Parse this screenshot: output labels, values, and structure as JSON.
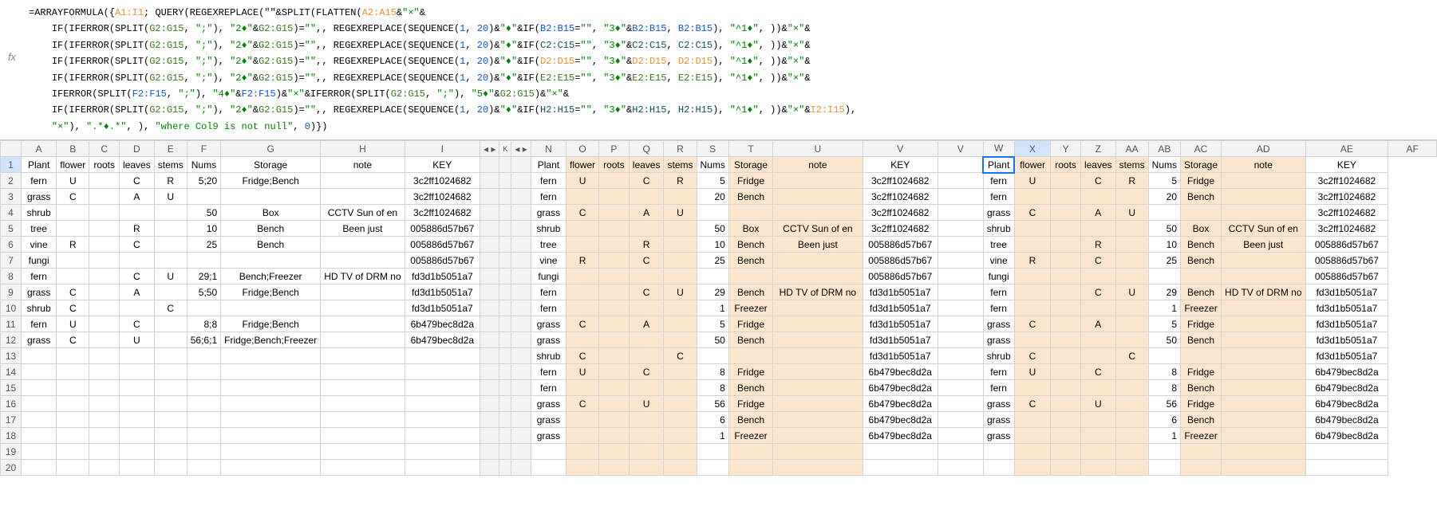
{
  "formula_bar": {
    "fx": "fx",
    "lines": [
      [
        {
          "t": "=ARRAYFORMULA({",
          "c": ""
        },
        {
          "t": "A1:I1",
          "c": "fr-orange"
        },
        {
          "t": "; QUERY(REGEXREPLACE(\"\"&SPLIT(FLATTEN(",
          "c": ""
        },
        {
          "t": "A2:A15",
          "c": "fr-orange"
        },
        {
          "t": "&",
          "c": ""
        },
        {
          "t": "\"×\"",
          "c": "fr-str"
        },
        {
          "t": "&",
          "c": ""
        }
      ],
      [
        {
          "t": "IF(IFERROR(SPLIT(",
          "c": ""
        },
        {
          "t": "G2:G15",
          "c": "fr-green"
        },
        {
          "t": ", ",
          "c": ""
        },
        {
          "t": "\";\"",
          "c": "fr-str"
        },
        {
          "t": "), ",
          "c": ""
        },
        {
          "t": "\"2♦\"",
          "c": "fr-str"
        },
        {
          "t": "&",
          "c": ""
        },
        {
          "t": "G2:G15",
          "c": "fr-green"
        },
        {
          "t": ")=",
          "c": ""
        },
        {
          "t": "\"\"",
          "c": "fr-str"
        },
        {
          "t": ",, REGEXREPLACE(SEQUENCE(",
          "c": ""
        },
        {
          "t": "1",
          "c": "fr-num"
        },
        {
          "t": ", ",
          "c": ""
        },
        {
          "t": "20",
          "c": "fr-num"
        },
        {
          "t": ")&",
          "c": ""
        },
        {
          "t": "\"♦\"",
          "c": "fr-str"
        },
        {
          "t": "&IF(",
          "c": ""
        },
        {
          "t": "B2:B15",
          "c": "fr-blue"
        },
        {
          "t": "=",
          "c": ""
        },
        {
          "t": "\"\"",
          "c": "fr-str"
        },
        {
          "t": ", ",
          "c": ""
        },
        {
          "t": "\"3♦\"",
          "c": "fr-str"
        },
        {
          "t": "&",
          "c": ""
        },
        {
          "t": "B2:B15",
          "c": "fr-blue"
        },
        {
          "t": ", ",
          "c": ""
        },
        {
          "t": "B2:B15",
          "c": "fr-blue"
        },
        {
          "t": "), ",
          "c": ""
        },
        {
          "t": "\"^1♦\"",
          "c": "fr-str"
        },
        {
          "t": ", ))&",
          "c": ""
        },
        {
          "t": "\"×\"",
          "c": "fr-str"
        },
        {
          "t": "&",
          "c": ""
        }
      ],
      [
        {
          "t": "IF(IFERROR(SPLIT(",
          "c": ""
        },
        {
          "t": "G2:G15",
          "c": "fr-green"
        },
        {
          "t": ", ",
          "c": ""
        },
        {
          "t": "\";\"",
          "c": "fr-str"
        },
        {
          "t": "), ",
          "c": ""
        },
        {
          "t": "\"2♦\"",
          "c": "fr-str"
        },
        {
          "t": "&",
          "c": ""
        },
        {
          "t": "G2:G15",
          "c": "fr-green"
        },
        {
          "t": ")=",
          "c": ""
        },
        {
          "t": "\"\"",
          "c": "fr-str"
        },
        {
          "t": ",, REGEXREPLACE(SEQUENCE(",
          "c": ""
        },
        {
          "t": "1",
          "c": "fr-num"
        },
        {
          "t": ", ",
          "c": ""
        },
        {
          "t": "20",
          "c": "fr-num"
        },
        {
          "t": ")&",
          "c": ""
        },
        {
          "t": "\"♦\"",
          "c": "fr-str"
        },
        {
          "t": "&IF(",
          "c": ""
        },
        {
          "t": "C2:C15",
          "c": "fr-teal"
        },
        {
          "t": "=",
          "c": ""
        },
        {
          "t": "\"\"",
          "c": "fr-str"
        },
        {
          "t": ", ",
          "c": ""
        },
        {
          "t": "\"3♦\"",
          "c": "fr-str"
        },
        {
          "t": "&",
          "c": ""
        },
        {
          "t": "C2:C15",
          "c": "fr-teal"
        },
        {
          "t": ", ",
          "c": ""
        },
        {
          "t": "C2:C15",
          "c": "fr-teal"
        },
        {
          "t": "), ",
          "c": ""
        },
        {
          "t": "\"^1♦\"",
          "c": "fr-str"
        },
        {
          "t": ", ))&",
          "c": ""
        },
        {
          "t": "\"×\"",
          "c": "fr-str"
        },
        {
          "t": "&",
          "c": ""
        }
      ],
      [
        {
          "t": "IF(IFERROR(SPLIT(",
          "c": ""
        },
        {
          "t": "G2:G15",
          "c": "fr-green"
        },
        {
          "t": ", ",
          "c": ""
        },
        {
          "t": "\";\"",
          "c": "fr-str"
        },
        {
          "t": "), ",
          "c": ""
        },
        {
          "t": "\"2♦\"",
          "c": "fr-str"
        },
        {
          "t": "&",
          "c": ""
        },
        {
          "t": "G2:G15",
          "c": "fr-green"
        },
        {
          "t": ")=",
          "c": ""
        },
        {
          "t": "\"\"",
          "c": "fr-str"
        },
        {
          "t": ",, REGEXREPLACE(SEQUENCE(",
          "c": ""
        },
        {
          "t": "1",
          "c": "fr-num"
        },
        {
          "t": ", ",
          "c": ""
        },
        {
          "t": "20",
          "c": "fr-num"
        },
        {
          "t": ")&",
          "c": ""
        },
        {
          "t": "\"♦\"",
          "c": "fr-str"
        },
        {
          "t": "&IF(",
          "c": ""
        },
        {
          "t": "D2:D15",
          "c": "fr-orange"
        },
        {
          "t": "=",
          "c": ""
        },
        {
          "t": "\"\"",
          "c": "fr-str"
        },
        {
          "t": ", ",
          "c": ""
        },
        {
          "t": "\"3♦\"",
          "c": "fr-str"
        },
        {
          "t": "&",
          "c": ""
        },
        {
          "t": "D2:D15",
          "c": "fr-orange"
        },
        {
          "t": ", ",
          "c": ""
        },
        {
          "t": "D2:D15",
          "c": "fr-orange"
        },
        {
          "t": "), ",
          "c": ""
        },
        {
          "t": "\"^1♦\"",
          "c": "fr-str"
        },
        {
          "t": ", ))&",
          "c": ""
        },
        {
          "t": "\"×\"",
          "c": "fr-str"
        },
        {
          "t": "&",
          "c": ""
        }
      ],
      [
        {
          "t": "IF(IFERROR(SPLIT(",
          "c": ""
        },
        {
          "t": "G2:G15",
          "c": "fr-green"
        },
        {
          "t": ", ",
          "c": ""
        },
        {
          "t": "\";\"",
          "c": "fr-str"
        },
        {
          "t": "), ",
          "c": ""
        },
        {
          "t": "\"2♦\"",
          "c": "fr-str"
        },
        {
          "t": "&",
          "c": ""
        },
        {
          "t": "G2:G15",
          "c": "fr-green"
        },
        {
          "t": ")=",
          "c": ""
        },
        {
          "t": "\"\"",
          "c": "fr-str"
        },
        {
          "t": ",, REGEXREPLACE(SEQUENCE(",
          "c": ""
        },
        {
          "t": "1",
          "c": "fr-num"
        },
        {
          "t": ", ",
          "c": ""
        },
        {
          "t": "20",
          "c": "fr-num"
        },
        {
          "t": ")&",
          "c": ""
        },
        {
          "t": "\"♦\"",
          "c": "fr-str"
        },
        {
          "t": "&IF(",
          "c": ""
        },
        {
          "t": "E2:E15",
          "c": "fr-green"
        },
        {
          "t": "=",
          "c": ""
        },
        {
          "t": "\"\"",
          "c": "fr-str"
        },
        {
          "t": ", ",
          "c": ""
        },
        {
          "t": "\"3♦\"",
          "c": "fr-str"
        },
        {
          "t": "&",
          "c": ""
        },
        {
          "t": "E2:E15",
          "c": "fr-green"
        },
        {
          "t": ", ",
          "c": ""
        },
        {
          "t": "E2:E15",
          "c": "fr-green"
        },
        {
          "t": "), ",
          "c": ""
        },
        {
          "t": "\"^1♦\"",
          "c": "fr-str"
        },
        {
          "t": ", ))&",
          "c": ""
        },
        {
          "t": "\"×\"",
          "c": "fr-str"
        },
        {
          "t": "&",
          "c": ""
        }
      ],
      [
        {
          "t": "IFERROR(SPLIT(",
          "c": ""
        },
        {
          "t": "F2:F15",
          "c": "fr-blue"
        },
        {
          "t": ", ",
          "c": ""
        },
        {
          "t": "\";\"",
          "c": "fr-str"
        },
        {
          "t": "), ",
          "c": ""
        },
        {
          "t": "\"4♦\"",
          "c": "fr-str"
        },
        {
          "t": "&",
          "c": ""
        },
        {
          "t": "F2:F15",
          "c": "fr-blue"
        },
        {
          "t": ")&",
          "c": ""
        },
        {
          "t": "\"×\"",
          "c": "fr-str"
        },
        {
          "t": "&IFERROR(SPLIT(",
          "c": ""
        },
        {
          "t": "G2:G15",
          "c": "fr-green"
        },
        {
          "t": ", ",
          "c": ""
        },
        {
          "t": "\";\"",
          "c": "fr-str"
        },
        {
          "t": "), ",
          "c": ""
        },
        {
          "t": "\"5♦\"",
          "c": "fr-str"
        },
        {
          "t": "&",
          "c": ""
        },
        {
          "t": "G2:G15",
          "c": "fr-green"
        },
        {
          "t": ")&",
          "c": ""
        },
        {
          "t": "\"×\"",
          "c": "fr-str"
        },
        {
          "t": "&",
          "c": ""
        }
      ],
      [
        {
          "t": "IF(IFERROR(SPLIT(",
          "c": ""
        },
        {
          "t": "G2:G15",
          "c": "fr-green"
        },
        {
          "t": ", ",
          "c": ""
        },
        {
          "t": "\";\"",
          "c": "fr-str"
        },
        {
          "t": "), ",
          "c": ""
        },
        {
          "t": "\"2♦\"",
          "c": "fr-str"
        },
        {
          "t": "&",
          "c": ""
        },
        {
          "t": "G2:G15",
          "c": "fr-green"
        },
        {
          "t": ")=",
          "c": ""
        },
        {
          "t": "\"\"",
          "c": "fr-str"
        },
        {
          "t": ",, REGEXREPLACE(SEQUENCE(",
          "c": ""
        },
        {
          "t": "1",
          "c": "fr-num"
        },
        {
          "t": ", ",
          "c": ""
        },
        {
          "t": "20",
          "c": "fr-num"
        },
        {
          "t": ")&",
          "c": ""
        },
        {
          "t": "\"♦\"",
          "c": "fr-str"
        },
        {
          "t": "&IF(",
          "c": ""
        },
        {
          "t": "H2:H15",
          "c": "fr-teal"
        },
        {
          "t": "=",
          "c": ""
        },
        {
          "t": "\"\"",
          "c": "fr-str"
        },
        {
          "t": ", ",
          "c": ""
        },
        {
          "t": "\"3♦\"",
          "c": "fr-str"
        },
        {
          "t": "&",
          "c": ""
        },
        {
          "t": "H2:H15",
          "c": "fr-teal"
        },
        {
          "t": ", ",
          "c": ""
        },
        {
          "t": "H2:H15",
          "c": "fr-teal"
        },
        {
          "t": "), ",
          "c": ""
        },
        {
          "t": "\"^1♦\"",
          "c": "fr-str"
        },
        {
          "t": ", ))&",
          "c": ""
        },
        {
          "t": "\"×\"",
          "c": "fr-str"
        },
        {
          "t": "&",
          "c": ""
        },
        {
          "t": "I2:I15",
          "c": "fr-orange"
        },
        {
          "t": "),",
          "c": ""
        }
      ],
      [
        {
          "t": "\"×\"",
          "c": "fr-str"
        },
        {
          "t": "), ",
          "c": ""
        },
        {
          "t": "\".*♦.*\"",
          "c": "fr-str"
        },
        {
          "t": ", ), ",
          "c": ""
        },
        {
          "t": "\"where Col9 is not null\"",
          "c": "fr-str"
        },
        {
          "t": ", ",
          "c": ""
        },
        {
          "t": "0",
          "c": "fr-num"
        },
        {
          "t": ")})",
          "c": ""
        }
      ]
    ]
  },
  "columns": {
    "left_block": [
      "A",
      "B",
      "C",
      "D",
      "E",
      "F",
      "G",
      "H",
      "I"
    ],
    "left_widths": [
      50,
      40,
      40,
      40,
      40,
      40,
      120,
      100,
      100
    ],
    "splitter_left": "◂ ▸",
    "hidden_cols": "K",
    "splitter_right": "◂ ▸",
    "mid_block": [
      "N",
      "O",
      "P",
      "Q",
      "R",
      "S",
      "T",
      "U"
    ],
    "mid_widths": [
      50,
      40,
      40,
      40,
      40,
      40,
      60,
      120
    ],
    "right_block1": [
      "V",
      "W",
      "X",
      "Y",
      "Z",
      "AA",
      "AB",
      "AC",
      "AD",
      "AE",
      "AF"
    ],
    "right_widths1": [
      100,
      30,
      50,
      40,
      40,
      40,
      40,
      40,
      60,
      120,
      100
    ]
  },
  "headers": [
    "Plant",
    "flower",
    "roots",
    "leaves",
    "stems",
    "Nums",
    "Storage",
    "note",
    "KEY"
  ],
  "rows_left": [
    [
      "fern",
      "U",
      "",
      "C",
      "R",
      "5;20",
      "Fridge;Bench",
      "",
      "3c2ff1024682"
    ],
    [
      "grass",
      "C",
      "",
      "A",
      "U",
      "",
      "",
      "",
      "3c2ff1024682"
    ],
    [
      "shrub",
      "",
      "",
      "",
      "",
      "50",
      "Box",
      "CCTV Sun of en",
      "3c2ff1024682"
    ],
    [
      "tree",
      "",
      "",
      "R",
      "",
      "10",
      "Bench",
      "Been just",
      "005886d57b67"
    ],
    [
      "vine",
      "R",
      "",
      "C",
      "",
      "25",
      "Bench",
      "",
      "005886d57b67"
    ],
    [
      "fungi",
      "",
      "",
      "",
      "",
      "",
      "",
      "",
      "005886d57b67"
    ],
    [
      "fern",
      "",
      "",
      "C",
      "U",
      "29;1",
      "Bench;Freezer",
      "HD TV of DRM no",
      "fd3d1b5051a7"
    ],
    [
      "grass",
      "C",
      "",
      "A",
      "",
      "5;50",
      "Fridge;Bench",
      "",
      "fd3d1b5051a7"
    ],
    [
      "shrub",
      "C",
      "",
      "",
      "C",
      "",
      "",
      "",
      "fd3d1b5051a7"
    ],
    [
      "fern",
      "U",
      "",
      "C",
      "",
      "8;8",
      "Fridge;Bench",
      "",
      "6b479bec8d2a"
    ],
    [
      "grass",
      "C",
      "",
      "U",
      "",
      "56;6;1",
      "Fridge;Bench;Freezer",
      "",
      "6b479bec8d2a"
    ]
  ],
  "rows_mid": [
    [
      "fern",
      "U",
      "",
      "C",
      "R",
      "5",
      "Fridge",
      "",
      "3c2ff1024682"
    ],
    [
      "fern",
      "",
      "",
      "",
      "",
      "20",
      "Bench",
      "",
      "3c2ff1024682"
    ],
    [
      "grass",
      "C",
      "",
      "A",
      "U",
      "",
      "",
      "",
      "3c2ff1024682"
    ],
    [
      "shrub",
      "",
      "",
      "",
      "",
      "50",
      "Box",
      "CCTV Sun of en",
      "3c2ff1024682"
    ],
    [
      "tree",
      "",
      "",
      "R",
      "",
      "10",
      "Bench",
      "Been just",
      "005886d57b67"
    ],
    [
      "vine",
      "R",
      "",
      "C",
      "",
      "25",
      "Bench",
      "",
      "005886d57b67"
    ],
    [
      "fungi",
      "",
      "",
      "",
      "",
      "",
      "",
      "",
      "005886d57b67"
    ],
    [
      "fern",
      "",
      "",
      "C",
      "U",
      "29",
      "Bench",
      "HD TV of DRM no",
      "fd3d1b5051a7"
    ],
    [
      "fern",
      "",
      "",
      "",
      "",
      "1",
      "Freezer",
      "",
      "fd3d1b5051a7"
    ],
    [
      "grass",
      "C",
      "",
      "A",
      "",
      "5",
      "Fridge",
      "",
      "fd3d1b5051a7"
    ],
    [
      "grass",
      "",
      "",
      "",
      "",
      "50",
      "Bench",
      "",
      "fd3d1b5051a7"
    ],
    [
      "shrub",
      "C",
      "",
      "",
      "C",
      "",
      "",
      "",
      "fd3d1b5051a7"
    ],
    [
      "fern",
      "U",
      "",
      "C",
      "",
      "8",
      "Fridge",
      "",
      "6b479bec8d2a"
    ],
    [
      "fern",
      "",
      "",
      "",
      "",
      "8",
      "Bench",
      "",
      "6b479bec8d2a"
    ],
    [
      "grass",
      "C",
      "",
      "U",
      "",
      "56",
      "Fridge",
      "",
      "6b479bec8d2a"
    ],
    [
      "grass",
      "",
      "",
      "",
      "",
      "6",
      "Bench",
      "",
      "6b479bec8d2a"
    ],
    [
      "grass",
      "",
      "",
      "",
      "",
      "1",
      "Freezer",
      "",
      "6b479bec8d2a"
    ]
  ],
  "active_cell": "X1",
  "row_count": 20
}
